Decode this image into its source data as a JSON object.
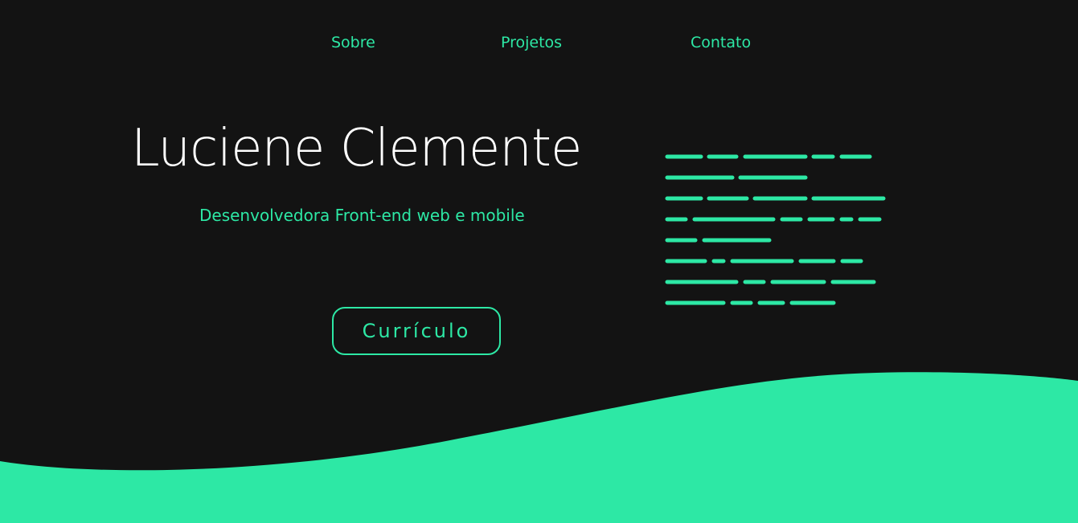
{
  "nav": {
    "items": [
      "Sobre",
      "Projetos",
      "Contato"
    ]
  },
  "hero": {
    "title": "Luciene Clemente",
    "subtitle": "Desenvolvedora Front-end web e mobile",
    "cv_button": "Currículo"
  },
  "decorations": {
    "code_lines_icon": "code-lines-icon"
  },
  "colors": {
    "background": "#131313",
    "accent": "#2de8a5",
    "title": "#ffffff"
  }
}
